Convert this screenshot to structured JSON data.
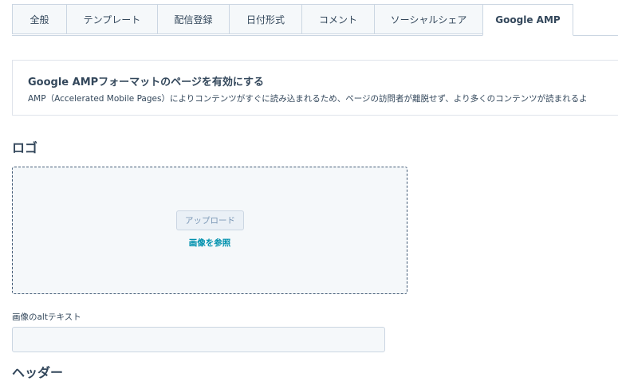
{
  "tabs": [
    {
      "label": "全般",
      "active": false
    },
    {
      "label": "テンプレート",
      "active": false
    },
    {
      "label": "配信登録",
      "active": false
    },
    {
      "label": "日付形式",
      "active": false
    },
    {
      "label": "コメント",
      "active": false
    },
    {
      "label": "ソーシャルシェア",
      "active": false
    },
    {
      "label": "Google AMP",
      "active": true
    }
  ],
  "amp": {
    "title": "Google AMPフォーマットのページを有効にする",
    "description": "AMP（Accelerated Mobile Pages）によりコンテンツがすぐに読み込まれるため、ページの訪問者が離脱せず、より多くのコンテンツが読まれるよ"
  },
  "logo": {
    "heading": "ロゴ",
    "upload_label": "アップロード",
    "browse_label": "画像を参照"
  },
  "alt_text": {
    "label": "画像のaltテキスト",
    "value": ""
  },
  "next_heading": "ヘッダー"
}
